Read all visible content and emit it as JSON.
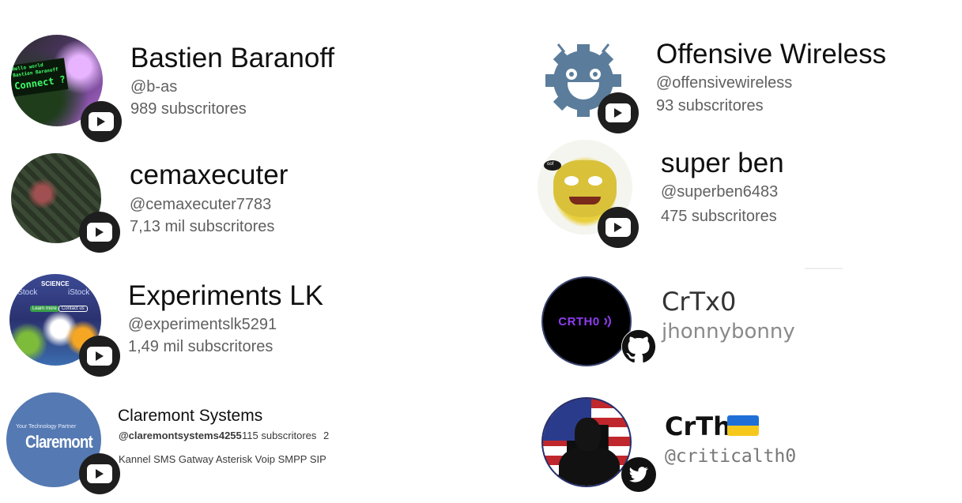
{
  "left_channels": [
    {
      "title": "Bastien Baranoff",
      "handle": "@b-as",
      "subscribers": "989 subscritores",
      "avatar_text": [
        "Hello world",
        "Bastien Baranoff",
        "Connect ?"
      ]
    },
    {
      "title": "cemaxecuter",
      "handle": "@cemaxecuter7783",
      "subscribers": "7,13 mil subscritores"
    },
    {
      "title": "Experiments LK",
      "handle": "@experimentslk5291",
      "subscribers": "1,49 mil subscritores",
      "avatar_text": [
        "SCIENCE",
        "iStock",
        "Learn more",
        "Contact us"
      ]
    },
    {
      "title": "Claremont Systems",
      "handle": "@claremontsystems4255",
      "subscribers": "115 subscritores",
      "overflow": "2",
      "description": "Kannel SMS Gatway Asterisk Voip SMPP SIP",
      "avatar_text": [
        "Your Technology Partner",
        "Claremont"
      ]
    }
  ],
  "right_channels": [
    {
      "title": "Offensive Wireless",
      "handle": "@offensivewireless",
      "subscribers": "93 subscritores"
    },
    {
      "title": "super ben",
      "handle": "@superben6483",
      "subscribers": "475 subscritores",
      "avatar_text": "oof"
    },
    {
      "title": "CrTx0",
      "handle": "jhonnybonny",
      "avatar_text": "CRTH0"
    },
    {
      "title": "CrTh",
      "flag": "🇺🇦",
      "handle": "@criticalth0"
    }
  ],
  "badges": {
    "youtube": "youtube-icon",
    "github": "github-icon",
    "twitter": "twitter-icon"
  },
  "colors": {
    "badge_bg": "#1e1e1e",
    "muted_text": "#606060",
    "crtx0_text": "#8e3df0",
    "gear_blue": "#5b7d9b"
  }
}
